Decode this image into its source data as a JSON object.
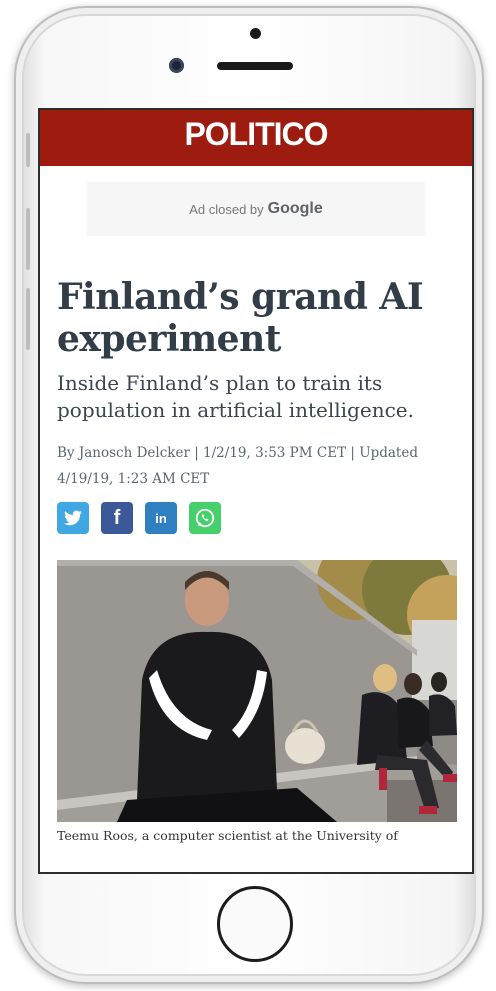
{
  "header": {
    "logo": "POLITICO"
  },
  "ad": {
    "text": "Ad closed by",
    "brand": "Google"
  },
  "article": {
    "headline": "Finland’s grand AI experiment",
    "subhead": "Inside Finland’s plan to train its population in artificial intelligence.",
    "byline": "By Janosch Delcker | 1/2/19, 3:53 PM CET | Updated 4/19/19, 1:23 AM CET",
    "share": [
      {
        "name": "twitter",
        "glyph": "t"
      },
      {
        "name": "facebook",
        "glyph": "f"
      },
      {
        "name": "linkedin",
        "glyph": "in"
      },
      {
        "name": "whatsapp",
        "glyph": "whatsapp-icon"
      }
    ],
    "photo_caption": "Teemu Roos, a computer scientist at the University of"
  },
  "colors": {
    "brand_red": "#9e1b0f",
    "headline": "#333d48",
    "twitter": "#3fa7e1",
    "facebook": "#3b5998",
    "linkedin": "#2f80c0",
    "whatsapp": "#45d06b"
  }
}
